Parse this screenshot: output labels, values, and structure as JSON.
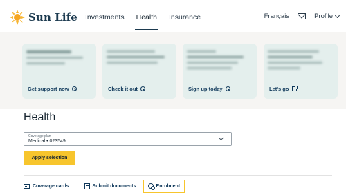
{
  "brand": {
    "name": "Sun Life",
    "logo_color": "#f5a623"
  },
  "nav": {
    "items": [
      {
        "label": "Investments"
      },
      {
        "label": "Health"
      },
      {
        "label": "Insurance"
      }
    ],
    "active": "Health"
  },
  "header_right": {
    "language": "Français",
    "profile": "Profile",
    "mail_icon": "mail-icon"
  },
  "promo_cards": [
    {
      "link": "Get support now",
      "icon": "arrow-circle-icon"
    },
    {
      "link": "Check it out",
      "icon": "arrow-circle-icon"
    },
    {
      "link": "Sign up today",
      "icon": "arrow-circle-icon"
    },
    {
      "link": "Let's go",
      "icon": "external-link-icon"
    }
  ],
  "main": {
    "title": "Health",
    "coverage_select": {
      "label": "Coverage plan",
      "value": "Medical • 023549"
    },
    "apply_label": "Apply selection"
  },
  "tabs": [
    {
      "label": "Coverage cards",
      "icon": "card-icon"
    },
    {
      "label": "Submit documents",
      "icon": "document-icon"
    },
    {
      "label": "Enrolment",
      "icon": "person-icon"
    }
  ],
  "colors": {
    "accent": "#f7c52d",
    "link": "#10395b",
    "card_bg": "#e4efed",
    "band_bg": "#f6f5f3"
  }
}
